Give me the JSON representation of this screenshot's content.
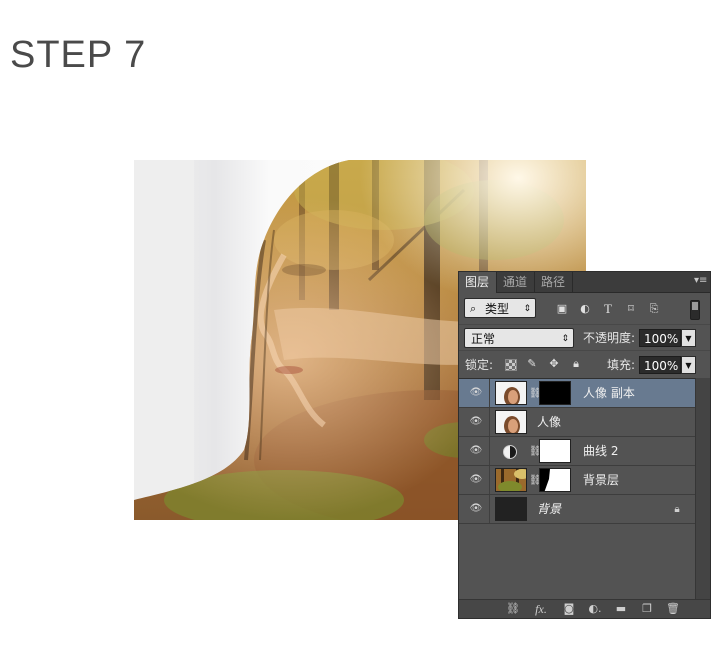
{
  "title": "STEP 7",
  "panel": {
    "tabs": [
      {
        "label": "图层",
        "active": true
      },
      {
        "label": "通道",
        "active": false
      },
      {
        "label": "路径",
        "active": false
      }
    ],
    "filter": {
      "label": "类型",
      "icon": "search-icon"
    },
    "filter_icons": [
      "image-filter-icon",
      "adjustment-filter-icon",
      "type-filter-icon",
      "shape-filter-icon",
      "smart-object-filter-icon"
    ],
    "blend_mode": "正常",
    "opacity_label": "不透明度:",
    "opacity_value": "100%",
    "lock_label": "锁定:",
    "fill_label": "填充:",
    "fill_value": "100%",
    "layers": [
      {
        "name": "人像 副本",
        "selected": true,
        "has_mask": true
      },
      {
        "name": "人像",
        "selected": false,
        "has_mask": false
      },
      {
        "name": "曲线 2",
        "selected": false,
        "adjustment": true
      },
      {
        "name": "背景层",
        "selected": false,
        "has_mask": true
      },
      {
        "name": "背景",
        "selected": false,
        "locked": true
      }
    ],
    "footer_icons": [
      "link-layers-icon",
      "fx-icon",
      "add-mask-icon",
      "new-adjustment-icon",
      "new-group-icon",
      "new-layer-icon",
      "trash-icon"
    ],
    "colors": {
      "panel_bg": "#535353",
      "selected_row": "#687a90",
      "tabbar_bg": "#3c3c3c"
    }
  }
}
